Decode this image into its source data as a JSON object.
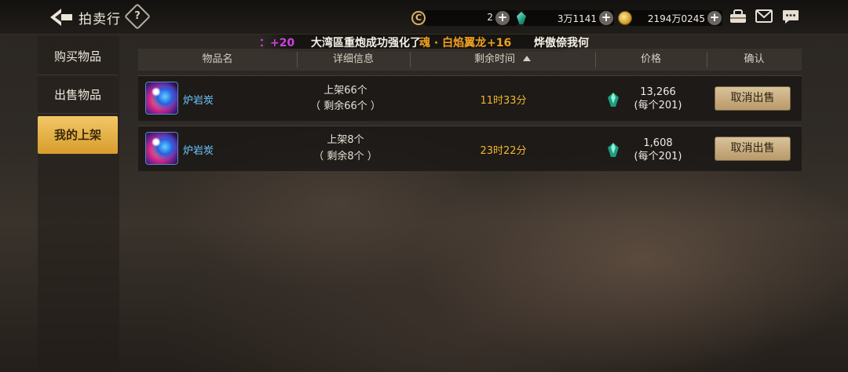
{
  "header": {
    "title": "拍卖行",
    "help_symbol": "?",
    "currencies": [
      {
        "icon": "c-token-icon",
        "value": "2"
      },
      {
        "icon": "green-gem-icon",
        "value": "3万1141"
      },
      {
        "icon": "gold-coin-icon",
        "value": "2194万0245"
      }
    ],
    "plus_symbol": "+"
  },
  "sidebar": {
    "items": [
      {
        "label": "购买物品",
        "active": false
      },
      {
        "label": "出售物品",
        "active": false
      },
      {
        "label": "我的上架",
        "active": true
      }
    ]
  },
  "marquee": {
    "plus": "：+20",
    "main": "大湾區重炮成功强化了",
    "item": "魂 · 白焰翼龙",
    "level": "+16",
    "next": "烨傲倷我何"
  },
  "table": {
    "columns": [
      "物品名",
      "详细信息",
      "剩余时间",
      "价格",
      "确认"
    ],
    "rows": [
      {
        "name": "炉岩炭",
        "listed": "上架66个",
        "remaining_qty": "（ 剩余66个 ）",
        "remaining_time": "11时33分",
        "price": "13,266",
        "unit_price": "(每个201)",
        "action": "取消出售"
      },
      {
        "name": "炉岩炭",
        "listed": "上架8个",
        "remaining_qty": "（ 剩余8个 ）",
        "remaining_time": "23时22分",
        "price": "1,608",
        "unit_price": "(每个201)",
        "action": "取消出售"
      }
    ]
  },
  "colors": {
    "active_tab": "#e2ad3e",
    "item_name": "#6fc8ff",
    "time": "#f0b62a",
    "marquee_item": "#f0a020",
    "marquee_plus": "#d040e0"
  }
}
